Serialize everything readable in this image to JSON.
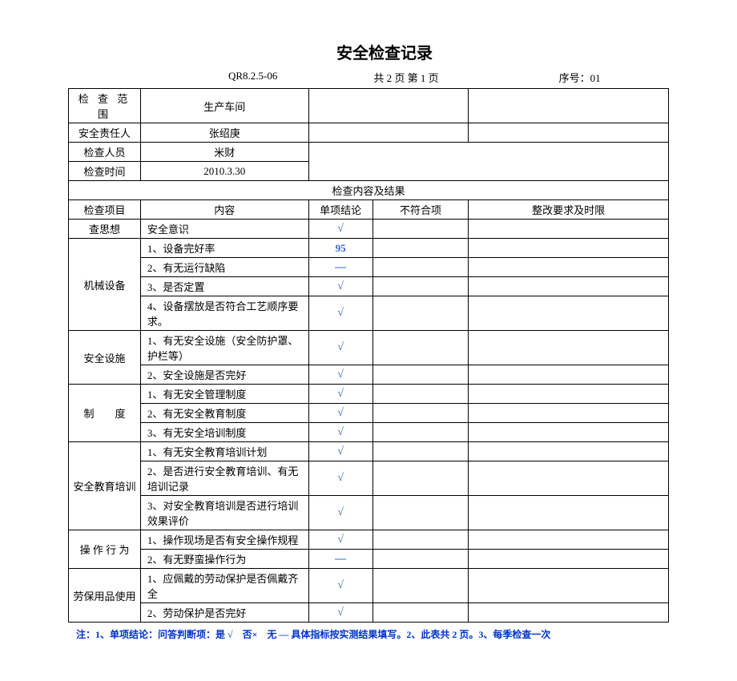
{
  "title": "安全检查记录",
  "meta": {
    "code": "QR8.2.5-06",
    "pages": "共 2 页  第 1 页",
    "serial": "序号：01"
  },
  "header": {
    "scope_label": "检 查 范 围",
    "scope_value": "生产车间",
    "responsible_label": "安全责任人",
    "responsible_value": "张绍庚",
    "inspector_label": "检查人员",
    "inspector_value": "米财",
    "time_label": "检查时间",
    "time_value": "2010.3.30"
  },
  "section_header": "检查内容及结果",
  "columns": {
    "item": "检查项目",
    "content": "内容",
    "result": "单项结论",
    "nonconform": "不符合项",
    "corrective": "整改要求及时限"
  },
  "rows": [
    {
      "cat": "查思想",
      "content": "安全意识",
      "result": "√",
      "span": 1
    },
    {
      "cat": "机械设备",
      "content": "1、设备完好率",
      "result": "95",
      "span": 4,
      "first": true
    },
    {
      "content": "2、有无运行缺陷",
      "result": "—"
    },
    {
      "content": "3、是否定置",
      "result": "√"
    },
    {
      "content": "4、设备摆放是否符合工艺顺序要求。",
      "result": "√"
    },
    {
      "cat": "安全设施",
      "content": "1、有无安全设施（安全防护罩、护栏等）",
      "result": "√",
      "span": 2,
      "first": true
    },
    {
      "content": "2、安全设施是否完好",
      "result": "√"
    },
    {
      "cat": "制　　度",
      "content": "1、有无安全管理制度",
      "result": "√",
      "span": 3,
      "first": true
    },
    {
      "content": "2、有无安全教育制度",
      "result": "√"
    },
    {
      "content": "3、有无安全培训制度",
      "result": "√"
    },
    {
      "cat": "安全教育培训",
      "content": "1、有无安全教育培训计划",
      "result": "√",
      "span": 3,
      "first": true
    },
    {
      "content": "2、是否进行安全教育培训、有无培训记录",
      "result": "√"
    },
    {
      "content": "3、对安全教育培训是否进行培训效果评价",
      "result": "√"
    },
    {
      "cat": "操 作 行 为",
      "content": "1、操作现场是否有安全操作规程",
      "result": "√",
      "span": 2,
      "first": true
    },
    {
      "content": "2、有无野蛮操作行为",
      "result": "—"
    },
    {
      "cat": "劳保用品使用",
      "content": "1、应佩戴的劳动保护是否佩戴齐全",
      "result": "√",
      "span": 2,
      "first": true
    },
    {
      "content": "2、劳动保护是否完好",
      "result": "√"
    }
  ],
  "note": "注：1、单项结论：问答判断项：是 √　否×　无 —  具体指标按实测结果填写。2、此表共 2 页。3、每季检查一次"
}
